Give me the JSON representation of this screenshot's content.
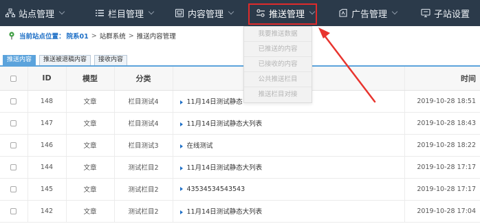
{
  "nav": {
    "items": [
      {
        "label": "站点管理",
        "icon": "sitemap-icon",
        "active": false
      },
      {
        "label": "栏目管理",
        "icon": "list-icon",
        "active": false
      },
      {
        "label": "内容管理",
        "icon": "document-icon",
        "active": false
      },
      {
        "label": "推送管理",
        "icon": "sliders-icon",
        "active": true
      },
      {
        "label": "广告管理",
        "icon": "ad-icon",
        "active": false
      },
      {
        "label": "子站设置",
        "icon": "monitor-icon",
        "active": false
      }
    ],
    "dropdown": [
      "我要推送数据",
      "已推送的内容",
      "已接收的内容",
      "公共推送栏目",
      "推送栏目对接"
    ]
  },
  "breadcrumb": {
    "label": "当前站点位置：",
    "site": "院系01",
    "sep": ">",
    "path": [
      "站群系统",
      "推送内容管理"
    ]
  },
  "tabs": [
    "推送内容",
    "推送被退稿内容",
    "接收内容"
  ],
  "table": {
    "headers": {
      "id": "ID",
      "model": "模型",
      "category": "分类",
      "title": "",
      "time": "时间"
    },
    "rows": [
      {
        "id": "148",
        "model": "文章",
        "category": "栏目测试4",
        "title": "11月14日测试静态",
        "time": "2019-10-28 18:51"
      },
      {
        "id": "147",
        "model": "文章",
        "category": "栏目测试4",
        "title": "11月14日测试静态大列表",
        "time": "2019-10-28 18:43"
      },
      {
        "id": "146",
        "model": "文章",
        "category": "栏目测试3",
        "title": "在线测试",
        "time": "2019-10-28 18:22"
      },
      {
        "id": "144",
        "model": "文章",
        "category": "测试栏目2",
        "title": "11月14日测试静态大列表",
        "time": "2019-10-28 17:17"
      },
      {
        "id": "145",
        "model": "文章",
        "category": "测试栏目2",
        "title": "43534534543543",
        "time": "2019-10-28 17:17"
      },
      {
        "id": "142",
        "model": "文章",
        "category": "测试栏目2",
        "title": "11月14日测试静态大列表",
        "time": "2019-10-28 17:04"
      }
    ]
  },
  "colors": {
    "nav_bg": "#2b3a4a",
    "accent": "#5ba3dc",
    "highlight": "#e02b2b",
    "link": "#1e6fc6"
  }
}
